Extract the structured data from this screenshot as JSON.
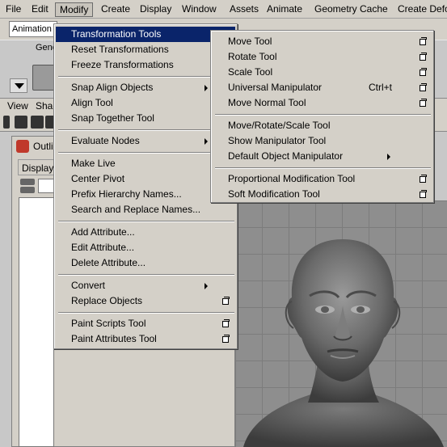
{
  "menubar": {
    "items": [
      "File",
      "Edit",
      "Modify",
      "Create",
      "Display",
      "Window",
      "Assets",
      "Animate",
      "Geometry Cache",
      "Create Defo"
    ],
    "active": "Modify"
  },
  "shelf": {
    "mode": "Animation",
    "tab": "Gene"
  },
  "panel": {
    "menus": [
      "View",
      "Shac"
    ]
  },
  "outliner": {
    "title": "Outli",
    "menu": "Display"
  },
  "modify_menu": {
    "groups": [
      [
        "Transformation Tools",
        "Reset Transformations",
        "Freeze Transformations"
      ],
      [
        "Snap Align Objects",
        "Align Tool",
        "Snap Together Tool"
      ],
      [
        "Evaluate Nodes"
      ],
      [
        "Make Live",
        "Center Pivot",
        "Prefix Hierarchy Names...",
        "Search and Replace Names..."
      ],
      [
        "Add Attribute...",
        "Edit Attribute...",
        "Delete Attribute..."
      ],
      [
        "Convert",
        "Replace Objects"
      ],
      [
        "Paint Scripts Tool",
        "Paint Attributes Tool"
      ]
    ]
  },
  "transform_menu": {
    "groups": [
      [
        "Move Tool",
        "Rotate Tool",
        "Scale Tool",
        "Universal Manipulator",
        "Move Normal Tool"
      ],
      [
        "Move/Rotate/Scale Tool",
        "Show Manipulator Tool",
        "Default Object Manipulator"
      ],
      [
        "Proportional Modification Tool",
        "Soft Modification Tool"
      ]
    ],
    "universal_shortcut": "Ctrl+t"
  },
  "colors": {
    "menu_bg": "#d4d0c8",
    "highlight": "#0a246a",
    "viewport": "#8e8e8e"
  }
}
